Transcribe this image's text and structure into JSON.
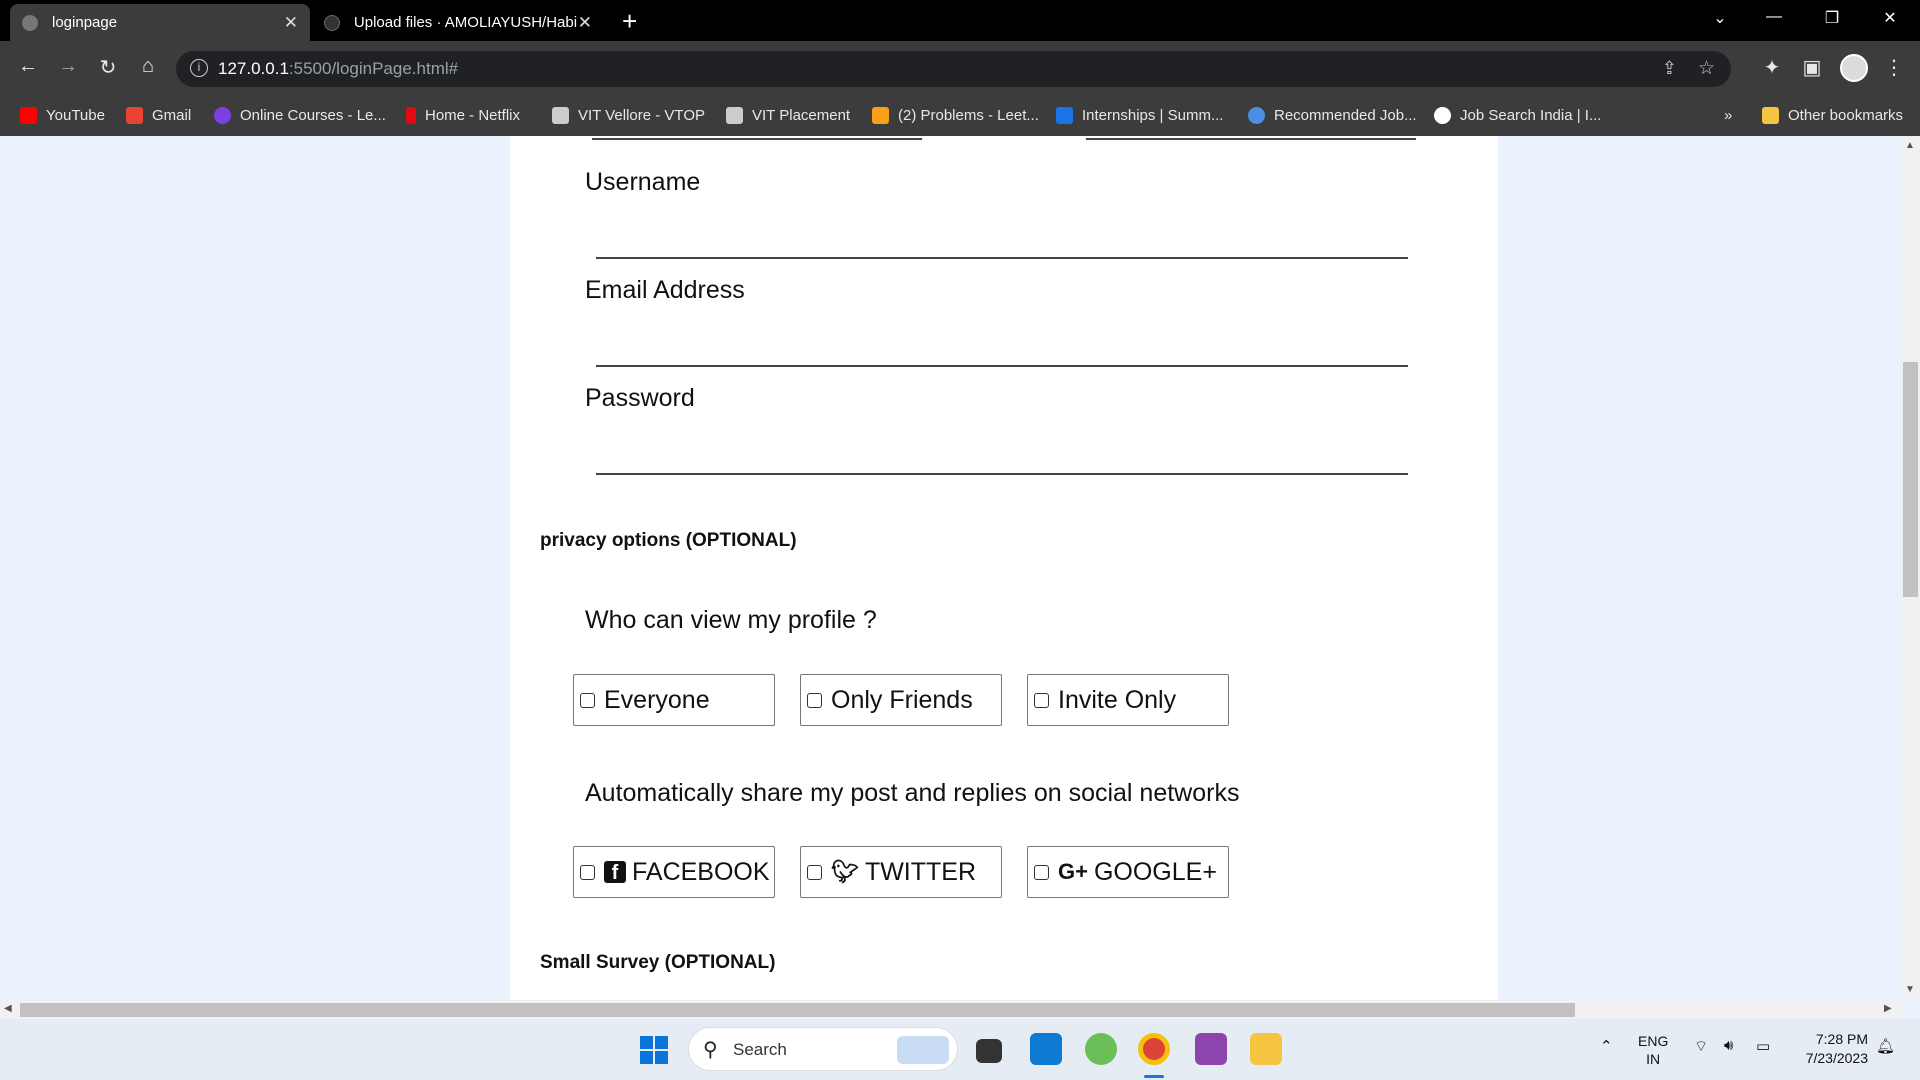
{
  "browser": {
    "tabs": [
      {
        "title": "loginpage",
        "active": true
      },
      {
        "title": "Upload files · AMOLIAYUSH/Habi",
        "active": false
      }
    ],
    "url_host": "127.0.0.1",
    "url_path": ":5500/loginPage.html#",
    "bookmarks": [
      {
        "label": "YouTube",
        "color": "#ff0000"
      },
      {
        "label": "Gmail",
        "color": "#ea4335"
      },
      {
        "label": "Online Courses - Le...",
        "color": "#7b3fe4"
      },
      {
        "label": "Home - Netflix",
        "color": "#e50914"
      },
      {
        "label": "VIT Vellore - VTOP",
        "color": "#cccccc"
      },
      {
        "label": "VIT Placement",
        "color": "#cccccc"
      },
      {
        "label": "(2) Problems - Leet...",
        "color": "#f89f1b"
      },
      {
        "label": "Internships | Summ...",
        "color": "#1a73e8"
      },
      {
        "label": "Recommended Job...",
        "color": "#4a90e2"
      },
      {
        "label": "Job Search India | I...",
        "color": "#ffffff"
      }
    ],
    "overflow": "»",
    "other_bookmarks": "Other bookmarks"
  },
  "form": {
    "fields": [
      {
        "label": "Username"
      },
      {
        "label": "Email Address"
      },
      {
        "label": "Password"
      }
    ],
    "privacy_title": "privacy options (OPTIONAL)",
    "profile_question": "Who can view my profile ?",
    "profile_options": [
      "Everyone",
      "Only Friends",
      "Invite Only"
    ],
    "share_question": "Automatically share my post and replies on social networks",
    "share_options": [
      "FACEBOOK",
      "TWITTER",
      "GOOGLE+"
    ],
    "survey_title": "Small Survey (OPTIONAL)"
  },
  "taskbar": {
    "search_placeholder": "Search",
    "lang_top": "ENG",
    "lang_bottom": "IN",
    "time": "7:28 PM",
    "date": "7/23/2023"
  },
  "icons": [
    "windows-start-icon",
    "search-icon",
    "vscode-icon",
    "chrome-icon",
    "file-explorer-icon",
    "wifi-icon",
    "volume-icon",
    "battery-icon"
  ],
  "colors": {
    "accent": "#1a73e8",
    "page_bg": "#eaf2fd",
    "chrome_dark": "#3c3c3c"
  }
}
